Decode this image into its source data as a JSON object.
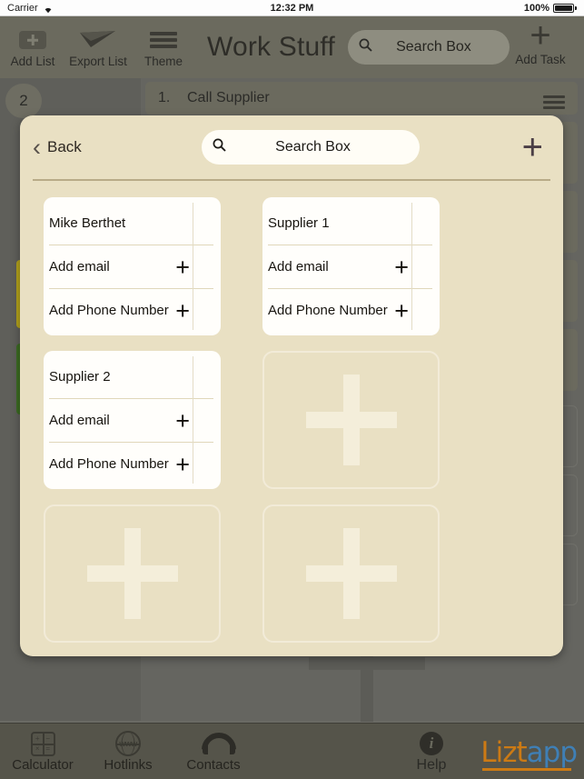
{
  "statusbar": {
    "carrier": "Carrier",
    "time": "12:32 PM",
    "battery": "100%",
    "wifi_icon": "wifi-icon",
    "battery_icon": "battery-full-icon"
  },
  "toolbar": {
    "add_list_label": "Add List",
    "export_list_label": "Export List",
    "theme_label": "Theme",
    "app_title": "Work Stuff",
    "search_placeholder": "Search Box",
    "search_icon": "search-icon",
    "add_task_label": "Add Task",
    "add_task_plus": "+"
  },
  "background": {
    "list_badge_count": "2",
    "task_number": "1.",
    "task_title": "Call Supplier",
    "menu_icon": "hamburger-icon"
  },
  "modal": {
    "back_label": "Back",
    "back_icon": "chevron-left-icon",
    "search_placeholder": "Search Box",
    "search_icon": "search-icon",
    "add_contact_plus": "+",
    "contacts": [
      {
        "name": "Mike Berthet",
        "email_label": "Add email",
        "phone_label": "Add Phone Number",
        "add_icon": "plus-icon"
      },
      {
        "name": "Supplier 1",
        "email_label": "Add email",
        "phone_label": "Add Phone Number",
        "add_icon": "plus-icon"
      },
      {
        "name": "Supplier 2",
        "email_label": "Add email",
        "phone_label": "Add Phone Number",
        "add_icon": "plus-icon"
      }
    ],
    "empty_slots": 3
  },
  "tabbar": {
    "items": [
      {
        "label": "Calculator",
        "icon": "calculator-icon"
      },
      {
        "label": "Hotlinks",
        "icon": "globe-www-icon"
      },
      {
        "label": "Contacts",
        "icon": "headset-icon"
      },
      {
        "label": "Help",
        "icon": "info-icon"
      }
    ],
    "logo": {
      "part1": "Liz",
      "part2": "t",
      "part3": "app"
    }
  },
  "colors": {
    "modal_bg": "#e9e0c3",
    "card_bg": "#fffefb",
    "toolbar_bg": "#6b6a5e",
    "tabbar_bg": "#55544a",
    "dim_bg": "#656560",
    "logo_orange": "#cc7a14",
    "logo_blue": "#3f7fb5",
    "strip_yellow": "#b3a21c",
    "strip_green": "#3c6b22"
  }
}
